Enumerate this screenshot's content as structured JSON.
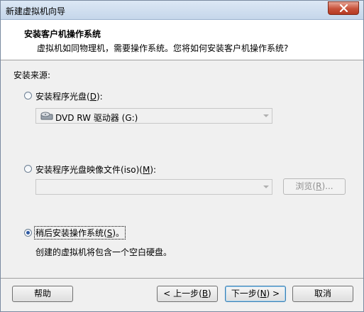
{
  "window": {
    "title": "新建虚拟机向导"
  },
  "header": {
    "title": "安装客户机操作系统",
    "description": "虚拟机如同物理机，需要操作系统。您将如何安装客户机操作系统?"
  },
  "source": {
    "label": "安装来源:",
    "option_disc": {
      "label_prefix": "安装程序光盘(",
      "mnemonic": "D",
      "label_suffix": "):",
      "selected": false,
      "drive_value": "DVD RW 驱动器 (G:)"
    },
    "option_iso": {
      "label_prefix": "安装程序光盘映像文件(iso)(",
      "mnemonic": "M",
      "label_suffix": "):",
      "selected": false,
      "path_value": "",
      "browse_prefix": "浏览(",
      "browse_mnemonic": "R",
      "browse_suffix": ")..."
    },
    "option_later": {
      "label_prefix": "稍后安装操作系统(",
      "mnemonic": "S",
      "label_suffix": ")。",
      "selected": true,
      "description": "创建的虚拟机将包含一个空白硬盘。"
    }
  },
  "buttons": {
    "help": "帮助",
    "back_prefix": "< 上一步(",
    "back_mnemonic": "B",
    "back_suffix": ")",
    "next_prefix": "下一步(",
    "next_mnemonic": "N",
    "next_suffix": ") >",
    "cancel": "取消"
  }
}
